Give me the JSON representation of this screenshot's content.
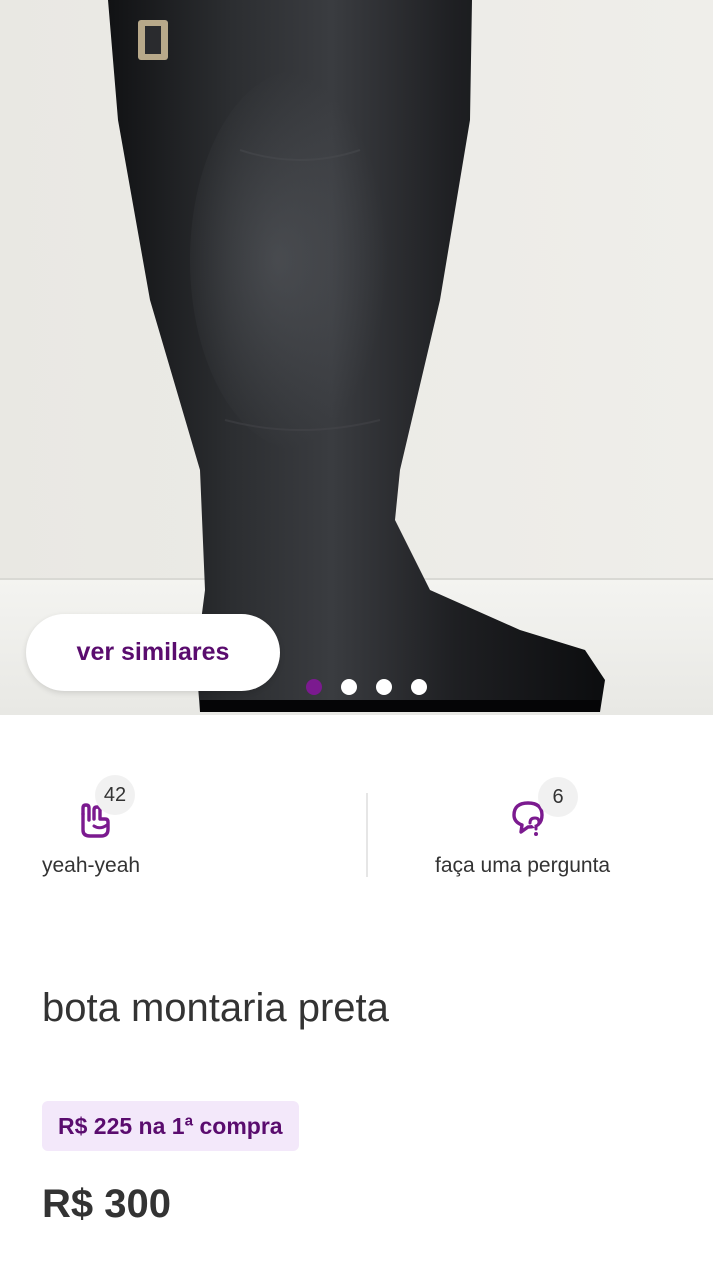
{
  "colors": {
    "brand_purple": "#5a0c6e",
    "accent_purple": "#7b1a8f",
    "promo_bg": "#f3e8fa"
  },
  "gallery": {
    "similar_button_label": "ver similares",
    "slide_count": 4,
    "active_slide": 1
  },
  "actions": {
    "like": {
      "icon": "hand-yeah-icon",
      "count": "42",
      "label": "yeah-yeah"
    },
    "ask": {
      "icon": "question-bubble-icon",
      "count": "6",
      "label": "faça uma pergunta"
    }
  },
  "product": {
    "title": "bota montaria preta",
    "promo_price": "R$ 225 na 1ª compra",
    "price": "R$ 300"
  }
}
